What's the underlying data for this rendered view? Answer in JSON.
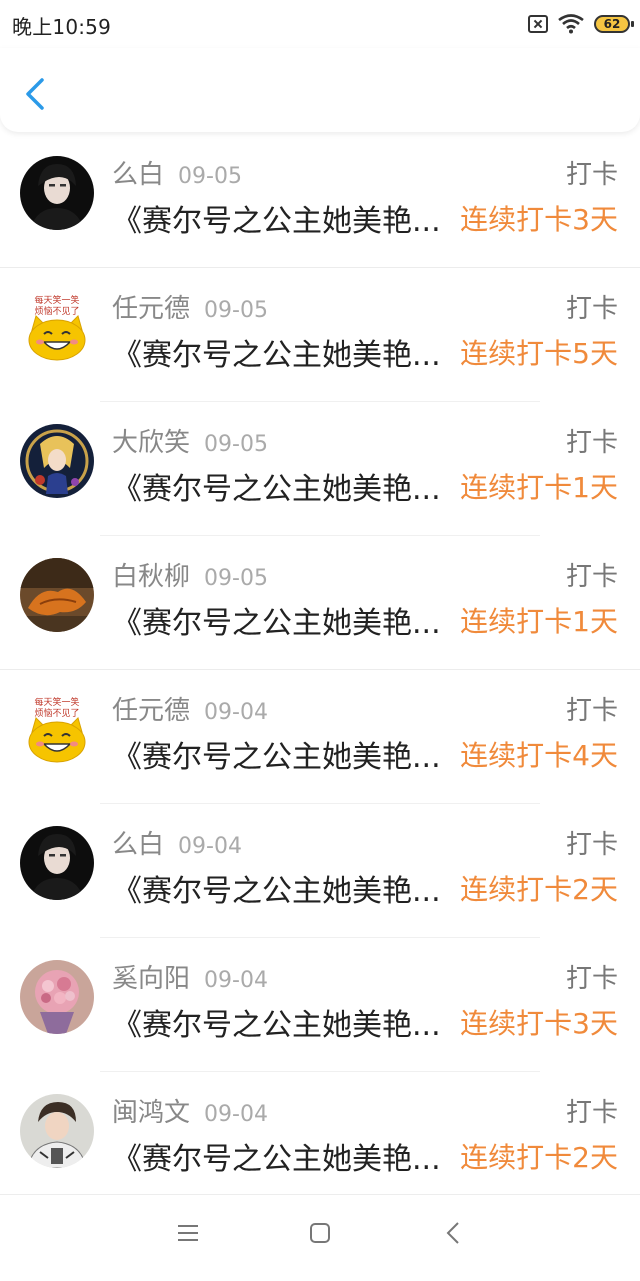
{
  "status_bar": {
    "time": "晚上10:59",
    "battery": "62",
    "icons": [
      "sim-off-icon",
      "wifi-icon",
      "battery-icon"
    ]
  },
  "header": {
    "back_icon": "chevron-left-icon"
  },
  "colors": {
    "accent_back": "#2b9ae8",
    "streak": "#f08a3b",
    "name": "#888888",
    "title": "#222222"
  },
  "records": [
    {
      "name": "么白",
      "date": "09-05",
      "action": "打卡",
      "title": "《赛尔号之公主她美艳...",
      "streak": "连续打卡3天",
      "avatar": "dark-portrait"
    },
    {
      "name": "任元德",
      "date": "09-05",
      "action": "打卡",
      "title": "《赛尔号之公主她美艳...",
      "streak": "连续打卡5天",
      "avatar": "cartoon-cat"
    },
    {
      "name": "大欣笑",
      "date": "09-05",
      "action": "打卡",
      "title": "《赛尔号之公主她美艳...",
      "streak": "连续打卡1天",
      "avatar": "anime-girl"
    },
    {
      "name": "白秋柳",
      "date": "09-05",
      "action": "打卡",
      "title": "《赛尔号之公主她美艳...",
      "streak": "连续打卡1天",
      "avatar": "autumn-leaf"
    },
    {
      "name": "任元德",
      "date": "09-04",
      "action": "打卡",
      "title": "《赛尔号之公主她美艳...",
      "streak": "连续打卡4天",
      "avatar": "cartoon-cat"
    },
    {
      "name": "么白",
      "date": "09-04",
      "action": "打卡",
      "title": "《赛尔号之公主她美艳...",
      "streak": "连续打卡2天",
      "avatar": "dark-portrait"
    },
    {
      "name": "奚向阳",
      "date": "09-04",
      "action": "打卡",
      "title": "《赛尔号之公主她美艳...",
      "streak": "连续打卡3天",
      "avatar": "flower-bouquet"
    },
    {
      "name": "闽鸿文",
      "date": "09-04",
      "action": "打卡",
      "title": "《赛尔号之公主她美艳...",
      "streak": "连续打卡2天",
      "avatar": "man-portrait"
    }
  ],
  "nav_bar": {
    "items": [
      "menu-icon",
      "home-square-icon",
      "back-triangle-icon"
    ]
  }
}
